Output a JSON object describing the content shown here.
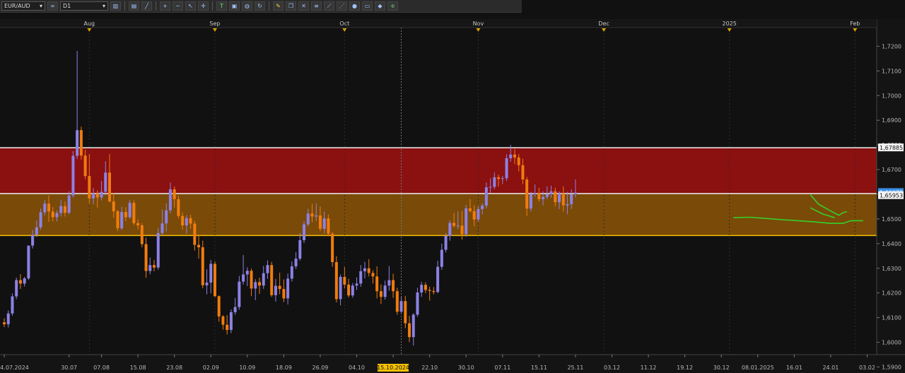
{
  "toolbar": {
    "symbol": "EUR/AUD",
    "timeframe": "D1",
    "buttons": [
      "candles-icon",
      "link-icon",
      "bar-chart-icon",
      "line-chart-icon",
      "zoom-in-icon",
      "zoom-out-icon",
      "cursor-icon",
      "crosshair-icon",
      "text-icon",
      "save-icon",
      "globe-icon",
      "pencil-icon",
      "refresh-icon",
      "tools-icon",
      "indicator-icon",
      "trendline-icon",
      "fib-icon",
      "circle-icon",
      "window-icon",
      "eraser-icon",
      "levels-icon"
    ]
  },
  "colors": {
    "background": "#111111",
    "bull": "#8c82e6",
    "bear": "#f07c0e",
    "red_zone": "#8b1010",
    "orange_zone": "#7a4a08",
    "drawing": "#33d12a",
    "price_badge": "#3a8ee6"
  },
  "chart_data": {
    "type": "candlestick",
    "symbol": "EUR/AUD",
    "timeframe": "D1",
    "ylim": [
      1.595,
      1.727
    ],
    "y_ticks": [
      "1,7200",
      "1,7100",
      "1,7000",
      "1,6900",
      "1,6800",
      "1,6700",
      "1,6600",
      "1,6500",
      "1,6400",
      "1,6300",
      "1,6200",
      "1,6100",
      "1,6000",
      "1,5900"
    ],
    "y_tick_values": [
      1.72,
      1.71,
      1.7,
      1.69,
      1.68,
      1.67,
      1.66,
      1.65,
      1.64,
      1.63,
      1.62,
      1.61,
      1.6,
      1.59
    ],
    "x_labels": [
      {
        "label": "24.07.2024",
        "bar": 0
      },
      {
        "label": "30.07",
        "bar": 16
      },
      {
        "label": "07.08",
        "bar": 24
      },
      {
        "label": "15.08",
        "bar": 33
      },
      {
        "label": "23.08",
        "bar": 42
      },
      {
        "label": "02.09",
        "bar": 51
      },
      {
        "label": "10.09",
        "bar": 60
      },
      {
        "label": "18.09",
        "bar": 69
      },
      {
        "label": "26.09",
        "bar": 78
      },
      {
        "label": "04.10",
        "bar": 87
      },
      {
        "label": "15.10.2024",
        "bar": 96,
        "highlight": true
      },
      {
        "label": "22.10",
        "bar": 105
      },
      {
        "label": "30.10",
        "bar": 114
      },
      {
        "label": "07.11",
        "bar": 123
      },
      {
        "label": "15.11",
        "bar": 132
      },
      {
        "label": "25.11",
        "bar": 141
      },
      {
        "label": "03.12",
        "bar": 150
      },
      {
        "label": "11.12",
        "bar": 159
      },
      {
        "label": "19.12",
        "bar": 168
      },
      {
        "label": "30.12",
        "bar": 177
      },
      {
        "label": "08.01.2025",
        "bar": 186
      },
      {
        "label": "16.01",
        "bar": 195
      },
      {
        "label": "24.01",
        "bar": 204
      },
      {
        "label": "03.02",
        "bar": 213
      }
    ],
    "month_markers": [
      {
        "label": "Aug",
        "bar": 21
      },
      {
        "label": "Sep",
        "bar": 52
      },
      {
        "label": "Oct",
        "bar": 84
      },
      {
        "label": "Nov",
        "bar": 117
      },
      {
        "label": "Dec",
        "bar": 148
      },
      {
        "label": "2025",
        "bar": 179
      },
      {
        "label": "Feb",
        "bar": 210
      }
    ],
    "zones": [
      {
        "name": "red-zone",
        "from": 1.6603,
        "to": 1.67885
      },
      {
        "name": "orange-zone",
        "from": 1.6433,
        "to": 1.6603
      }
    ],
    "price_labels": [
      {
        "value": "1,67885",
        "price": 1.67885,
        "style": "white"
      },
      {
        "value": "1,66075",
        "price": 1.66075,
        "style": "blue"
      },
      {
        "value": "1,65953",
        "price": 1.6595,
        "style": "white"
      }
    ],
    "crosshair_bar": 98,
    "green_lines": [
      {
        "name": "support-curve",
        "points": [
          [
            180,
            1.6505
          ],
          [
            184,
            1.6507
          ],
          [
            188,
            1.6502
          ],
          [
            192,
            1.6497
          ],
          [
            196,
            1.6493
          ],
          [
            200,
            1.6488
          ],
          [
            204,
            1.6482
          ],
          [
            207,
            1.6482
          ],
          [
            209,
            1.6493
          ],
          [
            212,
            1.6493
          ]
        ]
      },
      {
        "name": "projection-curve",
        "points": [
          [
            199,
            1.6598
          ],
          [
            201,
            1.656
          ],
          [
            204,
            1.6532
          ],
          [
            206,
            1.6515
          ],
          [
            207,
            1.6525
          ],
          [
            208,
            1.653
          ]
        ]
      },
      {
        "name": "projection-curve-2",
        "points": [
          [
            199,
            1.6545
          ],
          [
            202,
            1.652
          ],
          [
            205,
            1.6505
          ]
        ]
      }
    ],
    "candles": [
      [
        1.6081,
        1.6097,
        1.6062,
        1.6073
      ],
      [
        1.6073,
        1.6129,
        1.606,
        1.6117
      ],
      [
        1.6117,
        1.6198,
        1.6108,
        1.6186
      ],
      [
        1.6186,
        1.6262,
        1.6175,
        1.6252
      ],
      [
        1.6252,
        1.6276,
        1.6216,
        1.6238
      ],
      [
        1.6238,
        1.6265,
        1.6226,
        1.6259
      ],
      [
        1.6259,
        1.6388,
        1.6253,
        1.6392
      ],
      [
        1.6392,
        1.6455,
        1.638,
        1.6436
      ],
      [
        1.6436,
        1.6494,
        1.6427,
        1.6466
      ],
      [
        1.6466,
        1.6542,
        1.6456,
        1.6527
      ],
      [
        1.6527,
        1.6576,
        1.6515,
        1.6562
      ],
      [
        1.6562,
        1.6596,
        1.6488,
        1.653
      ],
      [
        1.653,
        1.6548,
        1.649,
        1.6507
      ],
      [
        1.6507,
        1.6534,
        1.649,
        1.6524
      ],
      [
        1.6524,
        1.6578,
        1.651,
        1.6552
      ],
      [
        1.6552,
        1.6571,
        1.651,
        1.6525
      ],
      [
        1.6525,
        1.6612,
        1.6518,
        1.6595
      ],
      [
        1.6595,
        1.6775,
        1.6587,
        1.6756
      ],
      [
        1.6756,
        1.7181,
        1.6744,
        1.686
      ],
      [
        1.686,
        1.6874,
        1.6741,
        1.6757
      ],
      [
        1.6757,
        1.6781,
        1.6661,
        1.6674
      ],
      [
        1.6674,
        1.6763,
        1.6562,
        1.6583
      ],
      [
        1.6583,
        1.6625,
        1.656,
        1.6603
      ],
      [
        1.6603,
        1.6616,
        1.6546,
        1.6587
      ],
      [
        1.6587,
        1.6654,
        1.6575,
        1.661
      ],
      [
        1.661,
        1.6734,
        1.6595,
        1.6688
      ],
      [
        1.6688,
        1.6763,
        1.6567,
        1.6571
      ],
      [
        1.6571,
        1.6605,
        1.6505,
        1.6531
      ],
      [
        1.6531,
        1.6536,
        1.6451,
        1.6462
      ],
      [
        1.6462,
        1.6549,
        1.6455,
        1.6528
      ],
      [
        1.6528,
        1.6547,
        1.6491,
        1.6507
      ],
      [
        1.6507,
        1.6578,
        1.6501,
        1.6565
      ],
      [
        1.6565,
        1.6575,
        1.6476,
        1.6483
      ],
      [
        1.6483,
        1.6498,
        1.6457,
        1.6474
      ],
      [
        1.6474,
        1.6483,
        1.6385,
        1.6398
      ],
      [
        1.6398,
        1.6424,
        1.6262,
        1.6289
      ],
      [
        1.6289,
        1.6343,
        1.6276,
        1.6313
      ],
      [
        1.6313,
        1.6334,
        1.6288,
        1.6303
      ],
      [
        1.6303,
        1.6464,
        1.6294,
        1.6443
      ],
      [
        1.6443,
        1.6538,
        1.6432,
        1.6482
      ],
      [
        1.6482,
        1.6564,
        1.645,
        1.6535
      ],
      [
        1.6535,
        1.6648,
        1.6522,
        1.662
      ],
      [
        1.662,
        1.6632,
        1.6546,
        1.658
      ],
      [
        1.658,
        1.6595,
        1.6502,
        1.6512
      ],
      [
        1.6512,
        1.6527,
        1.6456,
        1.6474
      ],
      [
        1.6474,
        1.6515,
        1.644,
        1.6503
      ],
      [
        1.6503,
        1.6517,
        1.646,
        1.6481
      ],
      [
        1.6481,
        1.6493,
        1.6372,
        1.6395
      ],
      [
        1.6395,
        1.6436,
        1.6339,
        1.6385
      ],
      [
        1.6385,
        1.6412,
        1.6219,
        1.6231
      ],
      [
        1.6231,
        1.6296,
        1.6194,
        1.6242
      ],
      [
        1.6242,
        1.6334,
        1.6198,
        1.6318
      ],
      [
        1.6318,
        1.6328,
        1.6183,
        1.6187
      ],
      [
        1.6187,
        1.619,
        1.6084,
        1.6105
      ],
      [
        1.6105,
        1.611,
        1.6051,
        1.6071
      ],
      [
        1.6071,
        1.611,
        1.6032,
        1.605
      ],
      [
        1.605,
        1.6133,
        1.6037,
        1.6122
      ],
      [
        1.6122,
        1.618,
        1.6111,
        1.6143
      ],
      [
        1.6143,
        1.6269,
        1.6132,
        1.6246
      ],
      [
        1.6246,
        1.6354,
        1.6234,
        1.6275
      ],
      [
        1.6275,
        1.6304,
        1.6228,
        1.629
      ],
      [
        1.629,
        1.6299,
        1.6187,
        1.6218
      ],
      [
        1.6218,
        1.6256,
        1.6171,
        1.6244
      ],
      [
        1.6244,
        1.6262,
        1.6196,
        1.623
      ],
      [
        1.623,
        1.631,
        1.6216,
        1.628
      ],
      [
        1.628,
        1.6332,
        1.6257,
        1.6313
      ],
      [
        1.6313,
        1.6326,
        1.6184,
        1.6191
      ],
      [
        1.6191,
        1.6257,
        1.6165,
        1.6229
      ],
      [
        1.6229,
        1.6282,
        1.6195,
        1.6216
      ],
      [
        1.6216,
        1.6255,
        1.6163,
        1.6178
      ],
      [
        1.6178,
        1.6279,
        1.6153,
        1.6258
      ],
      [
        1.6258,
        1.6328,
        1.6246,
        1.6308
      ],
      [
        1.6308,
        1.6365,
        1.6297,
        1.6339
      ],
      [
        1.6339,
        1.6443,
        1.6331,
        1.6414
      ],
      [
        1.6414,
        1.6491,
        1.6403,
        1.6478
      ],
      [
        1.6478,
        1.6541,
        1.6471,
        1.6522
      ],
      [
        1.6522,
        1.6561,
        1.6486,
        1.651
      ],
      [
        1.651,
        1.6563,
        1.6492,
        1.6514
      ],
      [
        1.6514,
        1.655,
        1.645,
        1.646
      ],
      [
        1.646,
        1.653,
        1.6442,
        1.6502
      ],
      [
        1.6502,
        1.6518,
        1.643,
        1.644
      ],
      [
        1.644,
        1.6448,
        1.6306,
        1.6325
      ],
      [
        1.6325,
        1.6349,
        1.6162,
        1.6175
      ],
      [
        1.6175,
        1.6275,
        1.615,
        1.6265
      ],
      [
        1.6265,
        1.6305,
        1.6218,
        1.6234
      ],
      [
        1.6234,
        1.6257,
        1.6182,
        1.619
      ],
      [
        1.619,
        1.624,
        1.6181,
        1.623
      ],
      [
        1.623,
        1.6263,
        1.6212,
        1.6238
      ],
      [
        1.6238,
        1.6313,
        1.6225,
        1.6288
      ],
      [
        1.6288,
        1.6326,
        1.6259,
        1.63
      ],
      [
        1.63,
        1.6337,
        1.6267,
        1.6281
      ],
      [
        1.6281,
        1.6292,
        1.6238,
        1.6267
      ],
      [
        1.6267,
        1.6308,
        1.6178,
        1.6207
      ],
      [
        1.6207,
        1.6235,
        1.6155,
        1.6184
      ],
      [
        1.6184,
        1.625,
        1.6173,
        1.623
      ],
      [
        1.623,
        1.6309,
        1.6209,
        1.6252
      ],
      [
        1.6252,
        1.6278,
        1.618,
        1.6207
      ],
      [
        1.6207,
        1.6221,
        1.6112,
        1.6124
      ],
      [
        1.6124,
        1.6183,
        1.6118,
        1.6167
      ],
      [
        1.6167,
        1.6188,
        1.6057,
        1.6077
      ],
      [
        1.6077,
        1.6107,
        1.6001,
        1.6021
      ],
      [
        1.6021,
        1.6118,
        1.5987,
        1.6112
      ],
      [
        1.6112,
        1.6221,
        1.6103,
        1.6202
      ],
      [
        1.6202,
        1.6245,
        1.6184,
        1.6233
      ],
      [
        1.6233,
        1.6243,
        1.6199,
        1.6212
      ],
      [
        1.6212,
        1.6225,
        1.6169,
        1.6208
      ],
      [
        1.6208,
        1.6224,
        1.6194,
        1.6204
      ],
      [
        1.6204,
        1.633,
        1.6199,
        1.6306
      ],
      [
        1.6306,
        1.64,
        1.6294,
        1.6375
      ],
      [
        1.6375,
        1.6443,
        1.6364,
        1.6431
      ],
      [
        1.6431,
        1.6495,
        1.6412,
        1.6484
      ],
      [
        1.6484,
        1.6524,
        1.6465,
        1.6472
      ],
      [
        1.6472,
        1.653,
        1.646,
        1.6473
      ],
      [
        1.6473,
        1.6532,
        1.6416,
        1.6438
      ],
      [
        1.6438,
        1.6557,
        1.6428,
        1.6543
      ],
      [
        1.6543,
        1.6581,
        1.6526,
        1.6532
      ],
      [
        1.6532,
        1.6555,
        1.647,
        1.6498
      ],
      [
        1.6498,
        1.6553,
        1.6488,
        1.654
      ],
      [
        1.654,
        1.6563,
        1.6519,
        1.6554
      ],
      [
        1.6554,
        1.6648,
        1.6543,
        1.6628
      ],
      [
        1.6628,
        1.6665,
        1.6604,
        1.663
      ],
      [
        1.663,
        1.6689,
        1.662,
        1.6669
      ],
      [
        1.6669,
        1.668,
        1.6631,
        1.6662
      ],
      [
        1.6662,
        1.6674,
        1.6641,
        1.6665
      ],
      [
        1.6665,
        1.6762,
        1.6654,
        1.6746
      ],
      [
        1.6746,
        1.68,
        1.6732,
        1.6761
      ],
      [
        1.6761,
        1.6783,
        1.6722,
        1.6749
      ],
      [
        1.6749,
        1.6763,
        1.6692,
        1.6718
      ],
      [
        1.6718,
        1.6744,
        1.6641,
        1.666
      ],
      [
        1.666,
        1.667,
        1.6512,
        1.6542
      ],
      [
        1.6542,
        1.661,
        1.653,
        1.66
      ],
      [
        1.66,
        1.664,
        1.659,
        1.6604
      ],
      [
        1.6604,
        1.6626,
        1.657,
        1.658
      ],
      [
        1.658,
        1.6612,
        1.6555,
        1.6589
      ],
      [
        1.6589,
        1.6632,
        1.658,
        1.66
      ],
      [
        1.66,
        1.6635,
        1.6586,
        1.6612
      ],
      [
        1.6612,
        1.6627,
        1.655,
        1.6568
      ],
      [
        1.6568,
        1.6612,
        1.654,
        1.6603
      ],
      [
        1.6603,
        1.6632,
        1.653,
        1.6555
      ],
      [
        1.6555,
        1.661,
        1.652,
        1.656
      ],
      [
        1.656,
        1.662,
        1.654,
        1.66
      ],
      [
        1.66,
        1.666,
        1.6588,
        1.6607
      ]
    ]
  }
}
